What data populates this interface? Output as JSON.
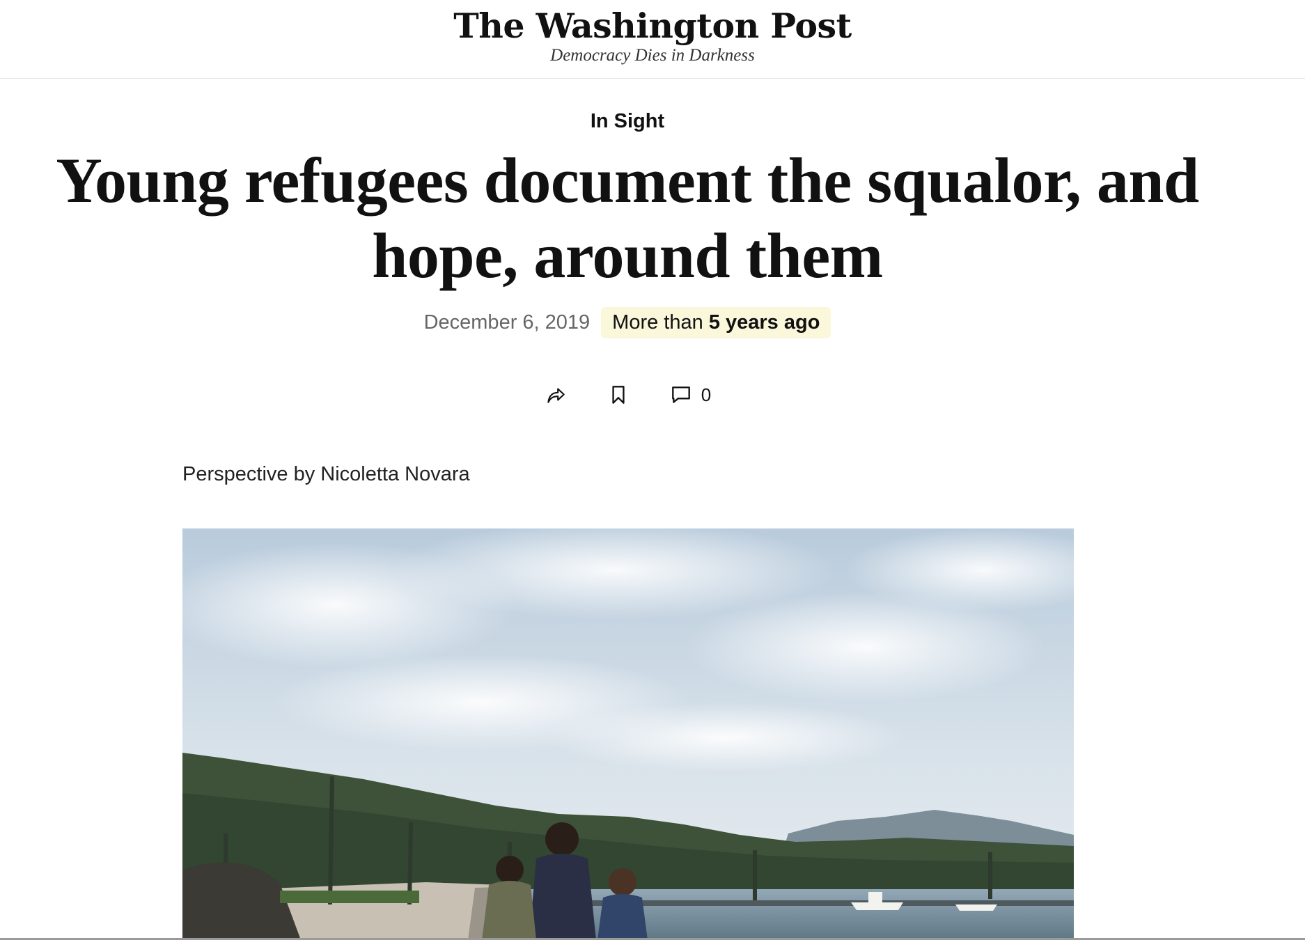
{
  "masthead": {
    "logo_text": "The Washington Post",
    "tagline": "Democracy Dies in Darkness"
  },
  "article": {
    "kicker": "In Sight",
    "headline": "Young refugees document the squalor, and hope, around them",
    "date": "December 6, 2019",
    "age_badge": {
      "prefix": "More than",
      "emphasis": "5 years ago",
      "background_color": "#fbf7da"
    },
    "actions": {
      "share_icon": "share-icon",
      "bookmark_icon": "bookmark-icon",
      "comment_icon": "comment-icon",
      "comment_count": "0"
    },
    "byline": "Perspective by Nicoletta Novara",
    "lead_image": {
      "subject": "harbor-with-children-photo",
      "sky_color": "#c9d8e6",
      "mountain_color": "#3d5238",
      "water_color": "#7f97a8"
    }
  }
}
